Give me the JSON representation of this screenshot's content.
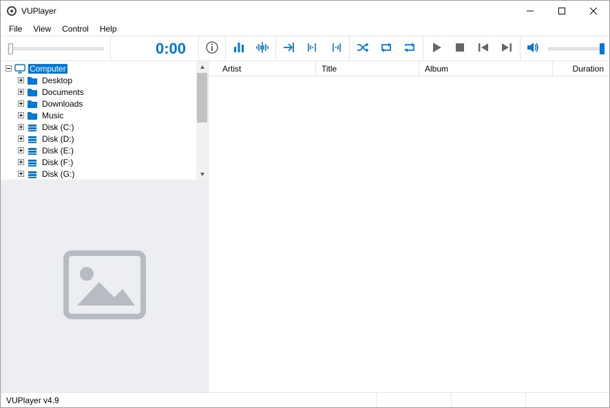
{
  "titlebar": {
    "title": "VUPlayer"
  },
  "menubar": {
    "items": [
      "File",
      "View",
      "Control",
      "Help"
    ]
  },
  "toolbar": {
    "time": "0:00"
  },
  "tree": {
    "root": {
      "label": "Computer",
      "selected": true
    },
    "children": [
      {
        "label": "Desktop",
        "icon": "folder"
      },
      {
        "label": "Documents",
        "icon": "folder"
      },
      {
        "label": "Downloads",
        "icon": "folder"
      },
      {
        "label": "Music",
        "icon": "folder"
      },
      {
        "label": "Disk (C:)",
        "icon": "disk"
      },
      {
        "label": "Disk (D:)",
        "icon": "disk"
      },
      {
        "label": "Disk (E:)",
        "icon": "disk"
      },
      {
        "label": "Disk (F:)",
        "icon": "disk"
      },
      {
        "label": "Disk (G:)",
        "icon": "disk"
      }
    ]
  },
  "playlist": {
    "columns": [
      "Artist",
      "Title",
      "Album",
      "Duration"
    ]
  },
  "statusbar": {
    "version": "VUPlayer v4.9"
  }
}
